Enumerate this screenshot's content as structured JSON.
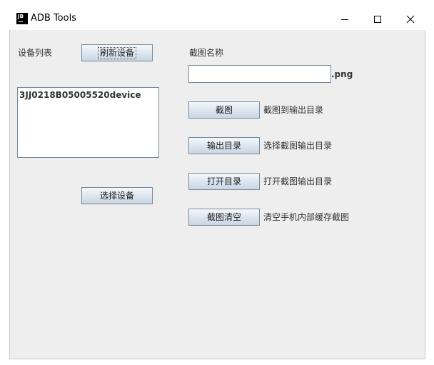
{
  "window": {
    "title": "ADB Tools",
    "icon_text": "JB",
    "controls": {
      "minimize_icon": "minimize-icon",
      "maximize_icon": "maximize-icon",
      "close_icon": "close-icon"
    }
  },
  "devices": {
    "label": "设备列表",
    "refresh_button": "刷新设备",
    "items": [
      "3JJ0218B05005520device"
    ],
    "select_button": "选择设备"
  },
  "screenshot": {
    "name_label": "截图名称",
    "name_value": "",
    "suffix": ".png",
    "actions": [
      {
        "button": "截图",
        "description": "截图到输出目录"
      },
      {
        "button": "输出目录",
        "description": "选择截图输出目录"
      },
      {
        "button": "打开目录",
        "description": "打开截图输出目录"
      },
      {
        "button": "截图清空",
        "description": "清空手机内部缓存截图"
      }
    ]
  },
  "colors": {
    "panel_background": "#eeeeee",
    "button_border": "#7a8a99",
    "text": "#333333"
  }
}
